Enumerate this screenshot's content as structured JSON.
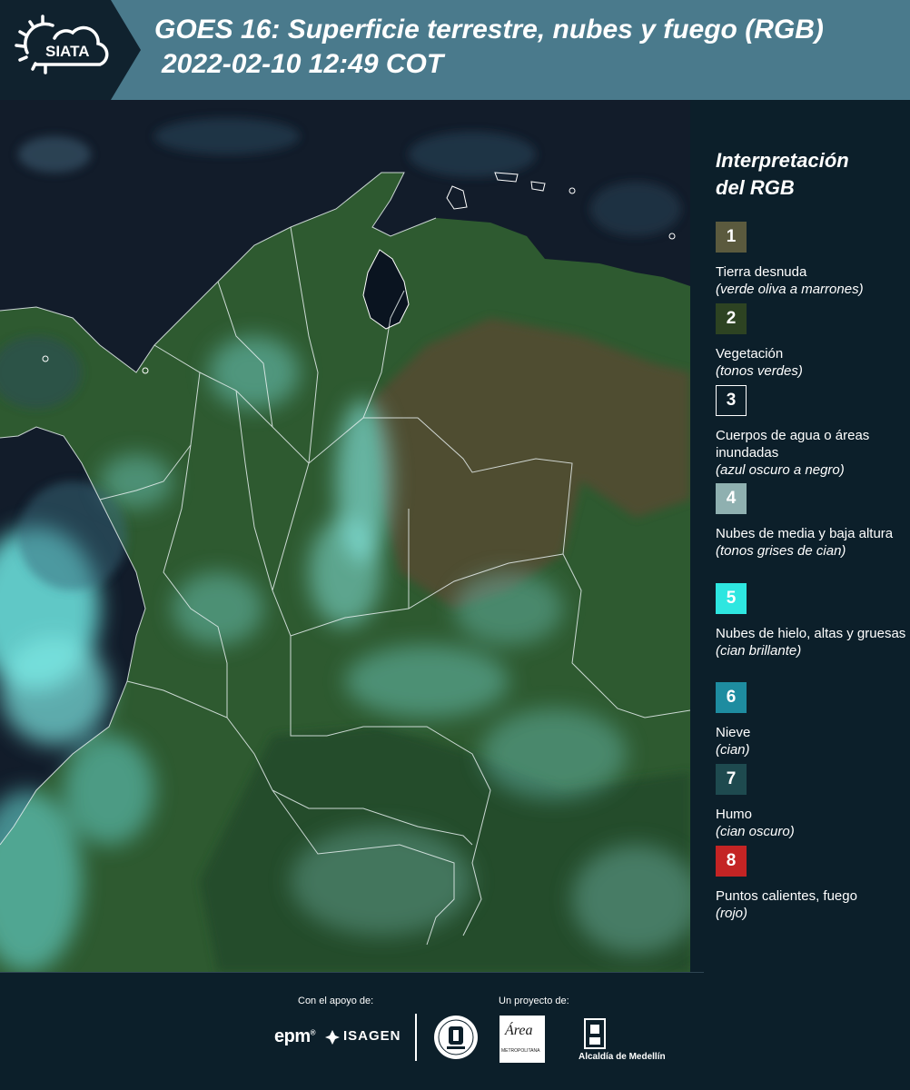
{
  "header": {
    "logo_text": "SIATA",
    "title_line1": "GOES 16: Superficie terrestre, nubes y fuego (RGB)",
    "title_line2": "2022-02-10 12:49 COT"
  },
  "legend": {
    "title_line1": "Interpretación",
    "title_line2": "del RGB",
    "items": [
      {
        "number": "1",
        "name": "Tierra desnuda",
        "desc": "(verde oliva a marrones)",
        "color": "#5b5a3e"
      },
      {
        "number": "2",
        "name": "Vegetación",
        "desc": "(tonos verdes)",
        "color": "#2d4322"
      },
      {
        "number": "3",
        "name": "Cuerpos de agua o áreas inundadas",
        "desc": "(azul oscuro a negro)",
        "color": "#0c1f2a"
      },
      {
        "number": "4",
        "name": "Nubes de media y baja altura",
        "desc": "(tonos grises de cian)",
        "color": "#8fb0b0"
      },
      {
        "number": "5",
        "name": "Nubes de hielo, altas y gruesas",
        "desc": "(cian brillante)",
        "color": "#2ee6e0"
      },
      {
        "number": "6",
        "name": "Nieve",
        "desc": "(cian)",
        "color": "#1e8ca0"
      },
      {
        "number": "7",
        "name": "Humo",
        "desc": "(cian oscuro)",
        "color": "#1e4a4f"
      },
      {
        "number": "8",
        "name": "Puntos calientes, fuego",
        "desc": "(rojo)",
        "color": "#c42424"
      }
    ]
  },
  "footer": {
    "support_label": "Con el apoyo de:",
    "project_label": "Un proyecto de:",
    "epm": "epm",
    "isagen": "ISAGEN",
    "area_script": "Área",
    "area_small": "METROPOLITANA",
    "alcaldia": "Alcaldía de Medellín"
  },
  "icons": {
    "logo": "sun-cloud-icon",
    "alcaldia": "building-icon"
  }
}
